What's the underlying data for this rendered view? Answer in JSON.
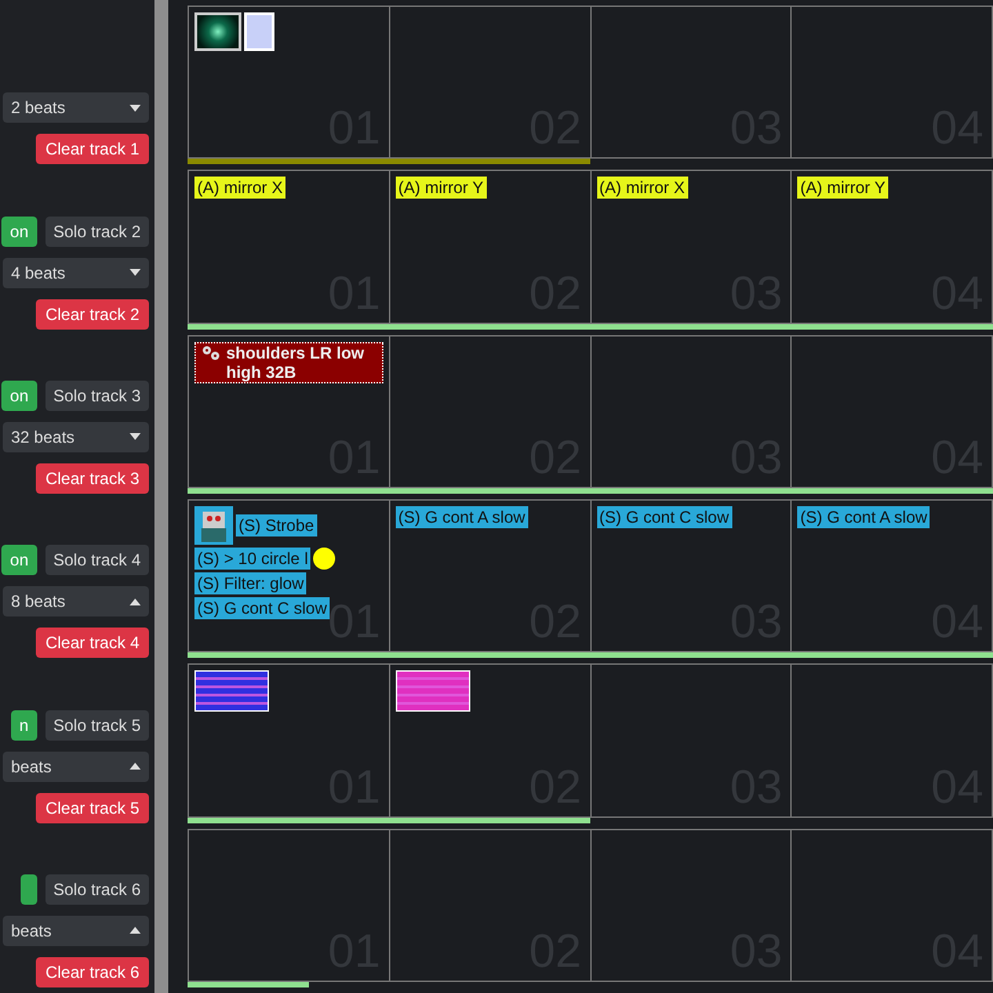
{
  "tracks": [
    {
      "beats": {
        "label": "2 beats",
        "open": false
      },
      "clear": "Clear track 1",
      "bar": {
        "color": "#8a8a00",
        "level": 0.5
      },
      "cells": [
        {
          "number": "01",
          "clips": [
            {
              "kind": "thumbnail"
            },
            {
              "kind": "swatch",
              "color": "#c8d0f8"
            }
          ]
        },
        {
          "number": "02"
        },
        {
          "number": "03"
        },
        {
          "number": "04"
        }
      ]
    },
    {
      "solo": {
        "on": "on",
        "on_active": true,
        "label": "Solo track 2"
      },
      "beats": {
        "label": "4 beats",
        "open": false
      },
      "clear": "Clear track 2",
      "bar": {
        "color": "#8fe08f",
        "level": 1
      },
      "cells": [
        {
          "number": "01",
          "clips": [
            {
              "kind": "label",
              "text": "(A) mirror X",
              "color": "#e6f51a"
            }
          ]
        },
        {
          "number": "02",
          "clips": [
            {
              "kind": "label",
              "text": "(A) mirror Y",
              "color": "#e6f51a"
            }
          ]
        },
        {
          "number": "03",
          "clips": [
            {
              "kind": "label",
              "text": "(A) mirror X",
              "color": "#e6f51a"
            }
          ]
        },
        {
          "number": "04",
          "clips": [
            {
              "kind": "label",
              "text": "(A) mirror Y",
              "color": "#e6f51a"
            }
          ]
        }
      ]
    },
    {
      "solo": {
        "on": "on",
        "on_active": true,
        "label": "Solo track 3"
      },
      "beats": {
        "label": "32 beats",
        "open": false
      },
      "clear": "Clear track 3",
      "bar": {
        "color": "#8fe08f",
        "level": 1
      },
      "cells": [
        {
          "number": "01",
          "clips": [
            {
              "kind": "effect",
              "text": "shoulders LR low high 32B",
              "color": "#8b0000"
            }
          ]
        },
        {
          "number": "02"
        },
        {
          "number": "03"
        },
        {
          "number": "04"
        }
      ]
    },
    {
      "solo": {
        "on": "on",
        "on_active": true,
        "label": "Solo track 4"
      },
      "beats": {
        "label": "8 beats",
        "open": true
      },
      "clear": "Clear track 4",
      "bar": {
        "color": "#8fe08f",
        "level": 1
      },
      "cells": [
        {
          "number": "01",
          "clips": [
            {
              "kind": "robot"
            },
            {
              "kind": "label",
              "text": "(S) Strobe",
              "color": "#29a8d8"
            },
            {
              "kind": "label",
              "text": "(S) > 10 circle l",
              "color": "#29a8d8"
            },
            {
              "kind": "dot",
              "color": "#ffff00"
            },
            {
              "kind": "label",
              "text": "(S) Filter: glow",
              "color": "#29a8d8"
            },
            {
              "kind": "label",
              "text": "(S) G cont C slow",
              "color": "#29a8d8"
            }
          ]
        },
        {
          "number": "02",
          "clips": [
            {
              "kind": "label",
              "text": "(S) G cont A slow",
              "color": "#29a8d8"
            }
          ]
        },
        {
          "number": "03",
          "clips": [
            {
              "kind": "label",
              "text": "(S) G cont C slow",
              "color": "#29a8d8"
            }
          ]
        },
        {
          "number": "04",
          "clips": [
            {
              "kind": "label",
              "text": "(S) G cont A slow",
              "color": "#29a8d8"
            }
          ]
        }
      ]
    },
    {
      "solo": {
        "on": "n",
        "on_active": true,
        "label": "Solo track 5"
      },
      "beats": {
        "label": "beats",
        "open": true
      },
      "clear": "Clear track 5",
      "bar": {
        "color": "#8fe08f",
        "level": 0.5
      },
      "cells": [
        {
          "number": "01",
          "clips": [
            {
              "kind": "stripes",
              "color": "#3030e0"
            }
          ]
        },
        {
          "number": "02",
          "clips": [
            {
              "kind": "stripes",
              "color": "#e030c0"
            }
          ]
        },
        {
          "number": "03"
        },
        {
          "number": "04"
        }
      ]
    },
    {
      "solo": {
        "on_active": true,
        "label": "Solo track 6"
      },
      "beats": {
        "label": "beats",
        "open": true
      },
      "clear": "Clear track 6",
      "bar": {
        "color": "#8fe08f",
        "level": 0.15
      },
      "cells": [
        {
          "number": "01"
        },
        {
          "number": "02"
        },
        {
          "number": "03"
        },
        {
          "number": "04"
        }
      ]
    }
  ]
}
